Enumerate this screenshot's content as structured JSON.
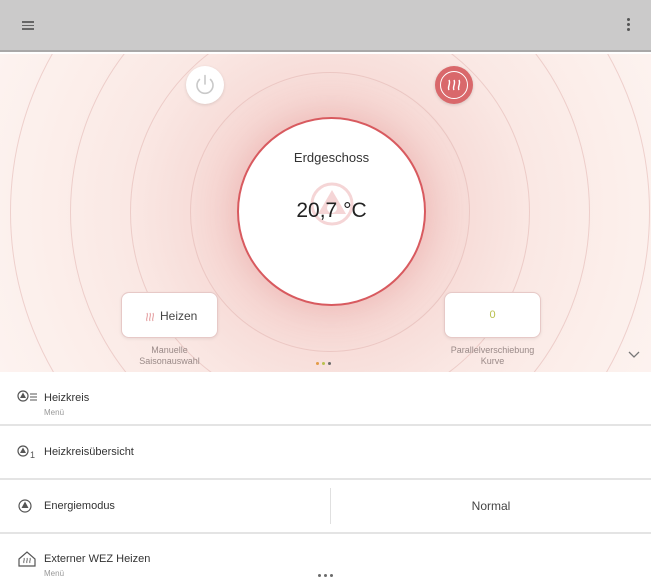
{
  "topbar": {
    "menu_icon": "hamburger-menu-icon",
    "more_icon": "more-vertical-icon",
    "background": "#cbcaca"
  },
  "hero": {
    "power_icon": "power-icon",
    "heating_mode_icon": "heating-waves-icon",
    "accent": "#d85a5f",
    "zone_name": "Erdgeschoss",
    "temperature": "20,7 °C",
    "season_card": {
      "label": "Heizen",
      "caption_line1": "Manuelle",
      "caption_line2": "Saisonauswahl"
    },
    "shift_card": {
      "value": "0",
      "caption_line1": "Parallelverschiebung",
      "caption_line2": "Kurve"
    },
    "pager_colors": [
      "#e39b47",
      "#b9c04e",
      "#6b6b6b"
    ]
  },
  "list": {
    "items": [
      {
        "label": "Heizkreis",
        "sub": "Menü",
        "icon": "heating-circuit-menu-icon"
      },
      {
        "label": "Heizkreisübersicht",
        "icon": "heating-circuit-overview-icon"
      },
      {
        "label": "Energiemodus",
        "value": "Normal",
        "icon": "energy-mode-icon"
      },
      {
        "label": "Externer WEZ Heizen",
        "sub": "Menü",
        "icon": "house-icon"
      }
    ]
  }
}
